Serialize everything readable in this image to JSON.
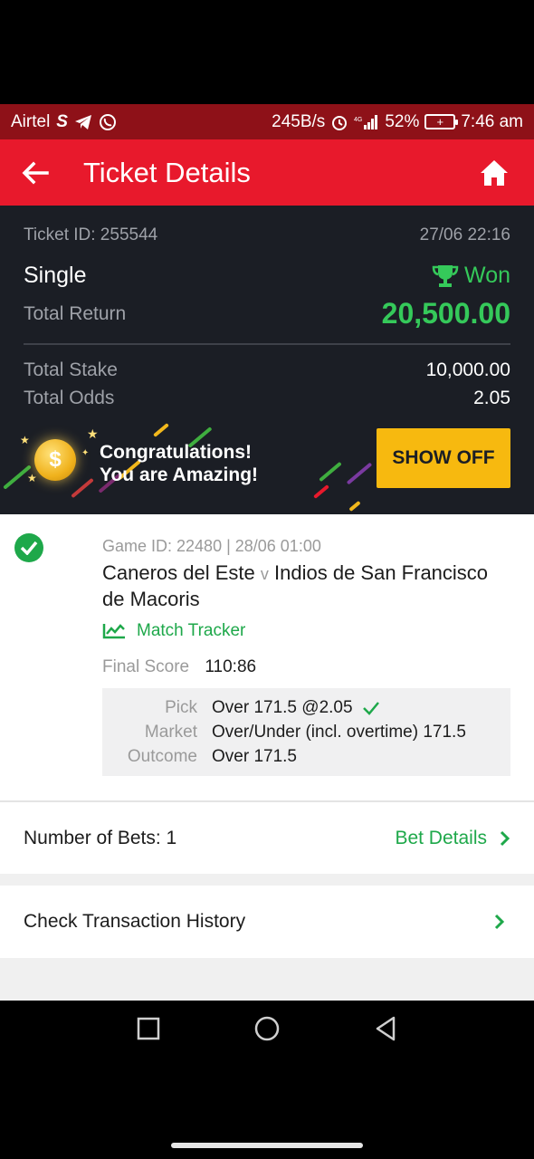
{
  "status_bar": {
    "carrier": "Airtel",
    "network_speed": "245B/s",
    "battery": "52%",
    "time": "7:46 am"
  },
  "app_bar": {
    "title": "Ticket Details"
  },
  "ticket": {
    "id_label": "Ticket ID: 255544",
    "date": "27/06 22:16",
    "type": "Single",
    "status": "Won",
    "total_return_label": "Total Return",
    "total_return": "20,500.00",
    "total_stake_label": "Total Stake",
    "total_stake": "10,000.00",
    "total_odds_label": "Total Odds",
    "total_odds": "2.05"
  },
  "promo": {
    "line1": "Congratulations!",
    "line2": "You are Amazing!",
    "coin_symbol": "$",
    "button": "SHOW OFF"
  },
  "game": {
    "id_line": "Game ID: 22480 | 28/06 01:00",
    "home_team": "Caneros del Este",
    "vs": "v",
    "away_team": "Indios de San Francisco de Macoris",
    "tracker_label": "Match Tracker",
    "final_score_label": "Final Score",
    "final_score": "110:86",
    "pick_label": "Pick",
    "pick": "Over 171.5 @2.05",
    "market_label": "Market",
    "market": "Over/Under (incl. overtime) 171.5",
    "outcome_label": "Outcome",
    "outcome": "Over 171.5"
  },
  "bets": {
    "count_label": "Number of Bets: 1",
    "details_link": "Bet Details"
  },
  "history": {
    "label": "Check Transaction History"
  },
  "colors": {
    "status_bar": "#8e1118",
    "app_bar": "#e8192c",
    "ticket_bg": "#1b1e25",
    "win_green": "#35c95a",
    "accent_yellow": "#f7b90f"
  }
}
